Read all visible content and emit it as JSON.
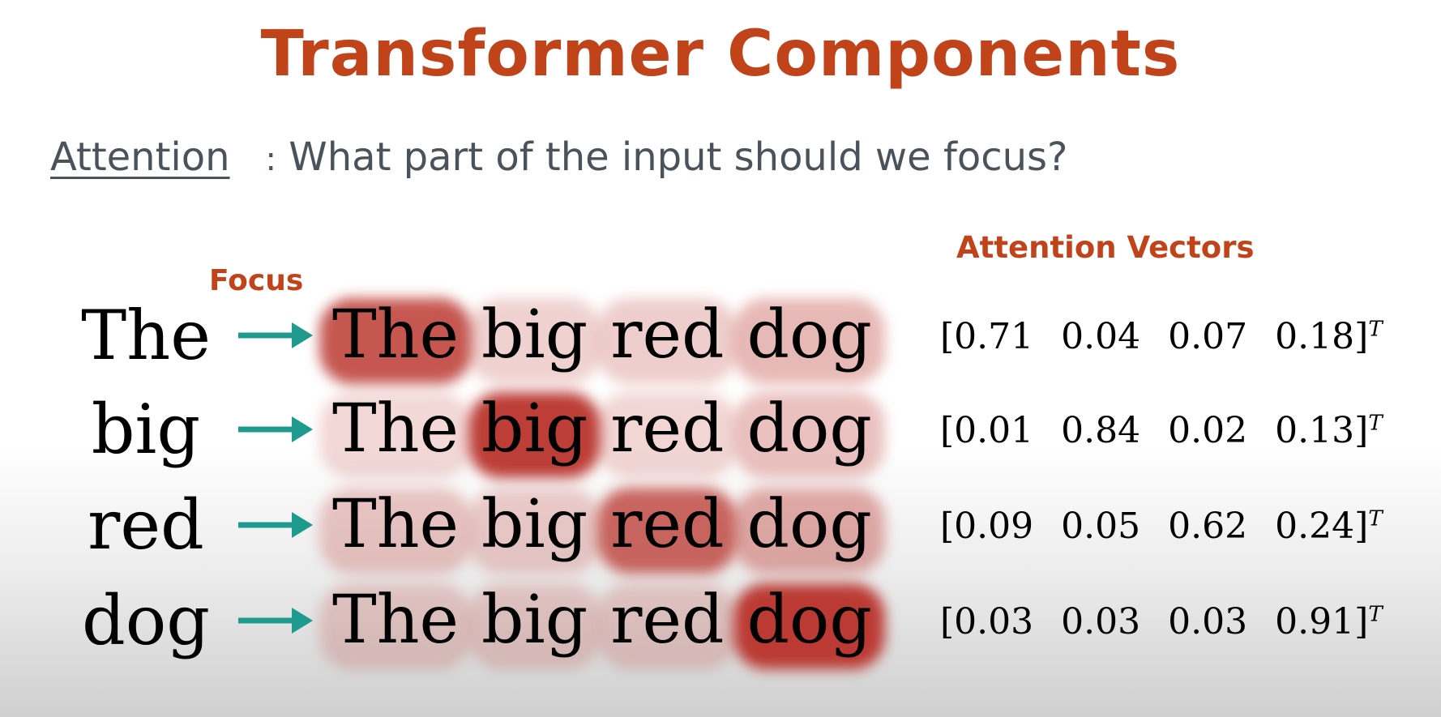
{
  "slide": {
    "title": "Transformer Components",
    "attention_term": "Attention",
    "attention_colon": ":",
    "attention_question": "What part of the input should we focus?",
    "focus_label": "Focus",
    "vectors_label": "Attention Vectors",
    "sentence_words": [
      "The",
      "big",
      "red",
      "dog"
    ],
    "transpose_symbol": "T",
    "highlight_color": "#b8322a",
    "arrow_color": "#1f9a8f",
    "rows": [
      {
        "query": "The",
        "weights": [
          "0.71",
          "0.04",
          "0.07",
          "0.18"
        ]
      },
      {
        "query": "big",
        "weights": [
          "0.01",
          "0.84",
          "0.02",
          "0.13"
        ]
      },
      {
        "query": "red",
        "weights": [
          "0.09",
          "0.05",
          "0.62",
          "0.24"
        ]
      },
      {
        "query": "dog",
        "weights": [
          "0.03",
          "0.03",
          "0.03",
          "0.91"
        ]
      }
    ]
  }
}
